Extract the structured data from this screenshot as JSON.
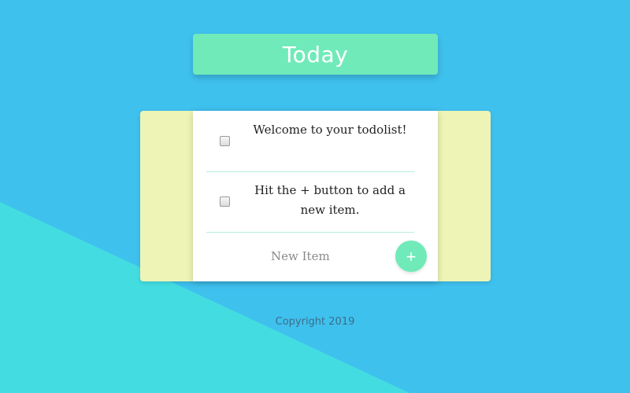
{
  "colors": {
    "background": "#3fc1ee",
    "accent_triangle": "#43dde1",
    "title_box": "#70eab9",
    "card_side": "#eef4b5",
    "divider": "#b3efd6"
  },
  "header": {
    "title": "Today"
  },
  "todo": {
    "items": [
      {
        "label": "Welcome to your todolist!",
        "checked": false
      },
      {
        "label": "Hit the + button to add a new item.",
        "checked": false
      }
    ],
    "new_item_placeholder": "New Item",
    "add_button_label": "+",
    "add_button_icon": "plus-icon"
  },
  "footer": {
    "copyright": "Copyright 2019"
  }
}
